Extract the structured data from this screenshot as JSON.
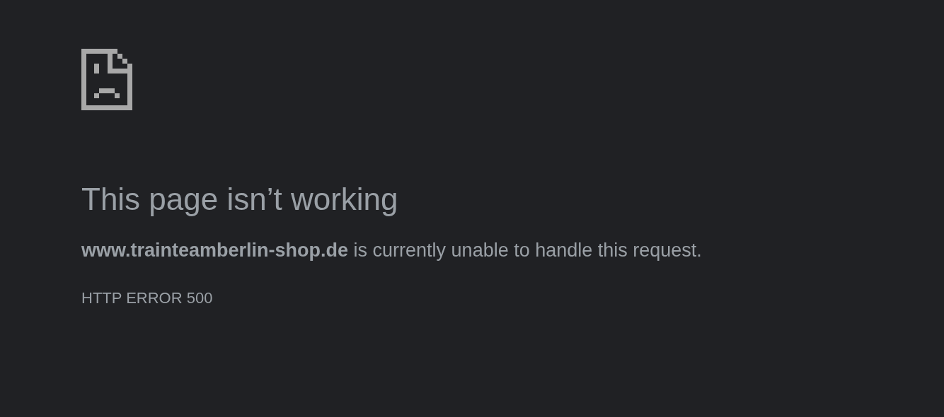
{
  "heading": "This page isn’t working",
  "message": "**www.trainteamberlin-shop.de** is currently unable to handle this request.",
  "error_code": "HTTP ERROR 500"
}
